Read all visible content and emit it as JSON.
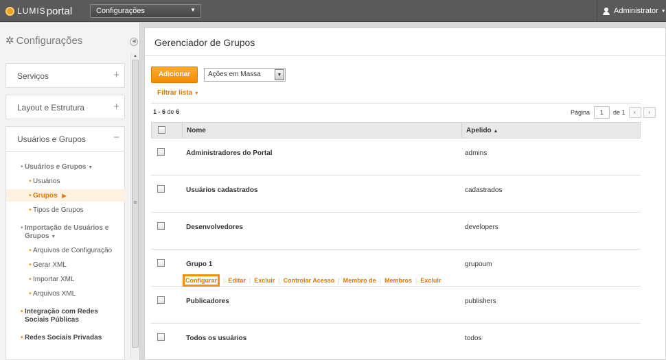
{
  "topbar": {
    "logo_prefix": "LUMIS",
    "logo_suffix": "portal",
    "site_select": "Configurações",
    "user": "Administrator"
  },
  "sidebar": {
    "title": "Configurações",
    "boxes": [
      {
        "label": "Serviços",
        "toggle": "+"
      },
      {
        "label": "Layout e Estrutura",
        "toggle": "+"
      }
    ],
    "open_box": {
      "label": "Usuários e Grupos",
      "toggle": "−"
    },
    "nav": {
      "sec1": "Usuários e Grupos",
      "usuarios": "Usuários",
      "grupos": "Grupos",
      "tipos": "Tipos de Grupos",
      "sec2": "Importação de Usuários e Grupos",
      "arquivos_config": "Arquivos de Configuração",
      "gerar_xml": "Gerar XML",
      "importar_xml": "Importar XML",
      "arquivos_xml": "Arquivos XML",
      "sec3": "Integração com Redes Sociais Públicas",
      "sec4": "Redes Sociais Privadas"
    }
  },
  "main": {
    "title": "Gerenciador de Grupos",
    "add_button": "Adicionar",
    "bulk_select": "Ações em Massa",
    "filter": "Filtrar lista",
    "range_start": "1 - 6",
    "range_of": "de",
    "range_total": "6",
    "page_label": "Página",
    "page_value": "1",
    "page_of": "de 1",
    "columns": {
      "name": "Nome",
      "alias": "Apelido"
    },
    "rows": [
      {
        "name": "Administradores do Portal",
        "alias": "admins"
      },
      {
        "name": "Usuários cadastrados",
        "alias": "cadastrados"
      },
      {
        "name": "Desenvolvedores",
        "alias": "developers"
      },
      {
        "name": "Grupo 1",
        "alias": "grupoum"
      },
      {
        "name": "Publicadores",
        "alias": "publishers"
      },
      {
        "name": "Todos os usuários",
        "alias": "todos"
      }
    ],
    "row_actions": [
      "Configurar",
      "Editar",
      "Excluir",
      "Controlar Acesso",
      "Membro de",
      "Membros",
      "Excluir"
    ]
  },
  "colors": {
    "accent": "#f38c00",
    "topbar": "#5a5a5a"
  }
}
